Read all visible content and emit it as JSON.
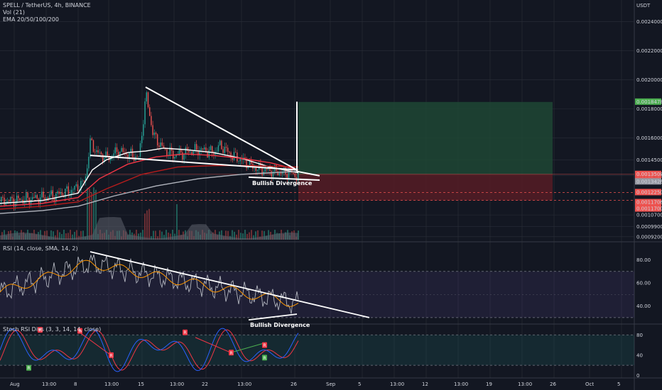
{
  "header": {
    "symbol_line": "SPELL / TetherUS, 4h, BINANCE",
    "vol_line": "Vol (21)",
    "ema_line": "EMA 20/50/100/200",
    "currency": "USDT"
  },
  "chart_data": [
    {
      "type": "line",
      "panel": "price",
      "title": "SPELL / TetherUS, 4h, BINANCE",
      "ylim": [
        0.00089,
        0.00255
      ],
      "y_ticks": [
        "0.0024000",
        "0.0022000",
        "0.0020000",
        "0.0018000",
        "0.0016000",
        "0.0014500",
        "0.0013426",
        "0.0010700",
        "0.0009900",
        "0.0009200"
      ],
      "x_ticks": [
        "Aug",
        "13:00",
        "8",
        "13:00",
        "15",
        "13:00",
        "22",
        "13:00",
        "26",
        "Sep",
        "5",
        "13:00",
        "12",
        "13:00",
        "19",
        "13:00",
        "26",
        "Oct",
        "5"
      ],
      "price_labels": [
        {
          "text": "0.0018478",
          "kind": "target"
        },
        {
          "text": "0.0013500",
          "kind": "current"
        },
        {
          "text": "01:42:57",
          "kind": "countdown"
        },
        {
          "text": "0.0013426",
          "kind": "ema"
        },
        {
          "text": "0.0012250",
          "kind": "stop"
        },
        {
          "text": "0.0011706",
          "kind": "stop"
        },
        {
          "text": "0.0011700",
          "kind": "stop"
        }
      ],
      "series": [
        {
          "name": "close",
          "color": "#e0e3eb",
          "values": [
            [
              0,
              0.00116
            ],
            [
              20,
              0.00117
            ],
            [
              40,
              0.00118
            ],
            [
              60,
              0.00119
            ],
            [
              80,
              0.00121
            ],
            [
              100,
              0.00124
            ],
            [
              115,
              0.00128
            ],
            [
              120,
              0.00134
            ],
            [
              127,
              0.00158
            ],
            [
              135,
              0.0015
            ],
            [
              150,
              0.00146
            ],
            [
              165,
              0.00151
            ],
            [
              180,
              0.00149
            ],
            [
              195,
              0.00146
            ],
            [
              205,
              0.0019
            ],
            [
              215,
              0.00162
            ],
            [
              230,
              0.00152
            ],
            [
              245,
              0.00148
            ],
            [
              260,
              0.0015
            ],
            [
              280,
              0.00152
            ],
            [
              300,
              0.0015
            ],
            [
              310,
              0.00155
            ],
            [
              325,
              0.00148
            ],
            [
              340,
              0.00145
            ],
            [
              355,
              0.0014
            ],
            [
              370,
              0.00138
            ],
            [
              385,
              0.00137
            ],
            [
              400,
              0.00136
            ],
            [
              410,
              0.00136
            ],
            [
              418,
              0.00133
            ],
            [
              420,
              0.00135
            ]
          ]
        },
        {
          "name": "EMA 20",
          "color": "#ffffff",
          "values": [
            [
              0,
              0.00115
            ],
            [
              60,
              0.00117
            ],
            [
              110,
              0.00122
            ],
            [
              130,
              0.00138
            ],
            [
              150,
              0.00145
            ],
            [
              180,
              0.0015
            ],
            [
              205,
              0.00151
            ],
            [
              230,
              0.00153
            ],
            [
              260,
              0.00152
            ],
            [
              300,
              0.0015
            ],
            [
              340,
              0.00146
            ],
            [
              380,
              0.0014
            ],
            [
              420,
              0.00136
            ]
          ]
        },
        {
          "name": "EMA 50",
          "color": "#f23645",
          "values": [
            [
              0,
              0.00113
            ],
            [
              60,
              0.00115
            ],
            [
              110,
              0.00119
            ],
            [
              140,
              0.00132
            ],
            [
              180,
              0.00142
            ],
            [
              220,
              0.00147
            ],
            [
              260,
              0.00149
            ],
            [
              300,
              0.00148
            ],
            [
              340,
              0.00146
            ],
            [
              380,
              0.00143
            ],
            [
              420,
              0.00138
            ]
          ]
        },
        {
          "name": "EMA 100",
          "color": "#b71c1c",
          "values": [
            [
              0,
              0.00111
            ],
            [
              60,
              0.00113
            ],
            [
              110,
              0.00116
            ],
            [
              150,
              0.00125
            ],
            [
              200,
              0.00135
            ],
            [
              250,
              0.0014
            ],
            [
              300,
              0.00141
            ],
            [
              350,
              0.00141
            ],
            [
              420,
              0.0014
            ]
          ]
        },
        {
          "name": "EMA 200",
          "color": "#b2b5be",
          "values": [
            [
              0,
              0.00108
            ],
            [
              60,
              0.0011
            ],
            [
              110,
              0.00113
            ],
            [
              160,
              0.0012
            ],
            [
              220,
              0.00127
            ],
            [
              280,
              0.00132
            ],
            [
              340,
              0.00135
            ],
            [
              420,
              0.00137
            ]
          ]
        }
      ],
      "annotations": [
        {
          "type": "trendline",
          "label": "",
          "points": [
            [
              205,
              0.00195
            ],
            [
              418,
              0.00138
            ]
          ]
        },
        {
          "type": "trendline",
          "label": "",
          "points": [
            [
              127,
              0.00148
            ],
            [
              418,
              0.00138
            ]
          ]
        },
        {
          "type": "trendline",
          "label": "Bullish Divergence",
          "points": [
            [
              350,
              0.00133
            ],
            [
              450,
              0.00131
            ]
          ]
        },
        {
          "type": "long_position",
          "entry": 0.00135,
          "target": 0.0018478,
          "stop": 0.00117
        }
      ]
    },
    {
      "type": "line",
      "panel": "rsi",
      "title": "RSI (14, close, SMA, 14, 2)",
      "ylim": [
        25,
        95
      ],
      "y_ticks": [
        "80.00",
        "60.00",
        "40.00"
      ],
      "bands": [
        70,
        30
      ],
      "annotations": [
        {
          "type": "trendline",
          "label": "",
          "points": [
            [
              127,
              87
            ],
            [
              520,
              30
            ]
          ]
        },
        {
          "type": "trendline",
          "label": "Bullish Divergence",
          "points": [
            [
              350,
              28
            ],
            [
              418,
              33
            ]
          ]
        }
      ]
    },
    {
      "type": "line",
      "panel": "stoch",
      "title": "Stoch RSI Divs (3, 3, 14, 14, close)",
      "ylim": [
        -5,
        100
      ],
      "y_ticks": [
        "80",
        "40",
        "0"
      ],
      "bands": [
        80,
        20
      ],
      "markers": [
        {
          "text": "R",
          "color": "#f23645"
        },
        {
          "text": "R",
          "color": "#f23645"
        },
        {
          "text": "R",
          "color": "#f23645"
        },
        {
          "text": "R",
          "color": "#f23645"
        },
        {
          "text": "R",
          "color": "#f23645"
        },
        {
          "text": "R",
          "color": "#f23645"
        },
        {
          "text": "R",
          "color": "#4caf50"
        },
        {
          "text": "R",
          "color": "#4caf50"
        }
      ]
    }
  ],
  "rsi_panel": {
    "title": "RSI (14, close, SMA, 14, 2)"
  },
  "stoch_panel": {
    "title": "Stoch RSI Divs (3, 3, 14, 14, close)"
  },
  "colors": {
    "bg": "#131722",
    "up": "#26a69a",
    "down": "#ef5350",
    "grid": "#2a2e39",
    "text": "#d1d4dc",
    "profit": "#1e4634",
    "loss": "#561c24"
  }
}
